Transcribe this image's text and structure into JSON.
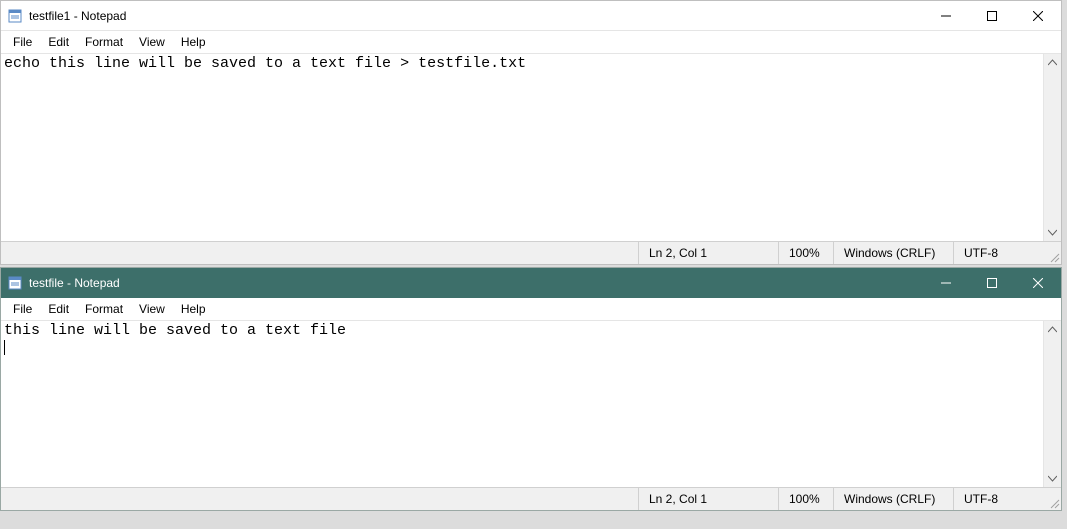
{
  "windows": [
    {
      "title": "testfile1 - Notepad",
      "active": false,
      "menu": [
        "File",
        "Edit",
        "Format",
        "View",
        "Help"
      ],
      "content_line1": "echo this line will be saved to a text file > testfile.txt",
      "status": {
        "lncol": "Ln 2, Col 1",
        "zoom": "100%",
        "eol": "Windows (CRLF)",
        "enc": "UTF-8"
      }
    },
    {
      "title": "testfile - Notepad",
      "active": true,
      "menu": [
        "File",
        "Edit",
        "Format",
        "View",
        "Help"
      ],
      "content_line1": "this line will be saved to a text file",
      "status": {
        "lncol": "Ln 2, Col 1",
        "zoom": "100%",
        "eol": "Windows (CRLF)",
        "enc": "UTF-8"
      }
    }
  ]
}
